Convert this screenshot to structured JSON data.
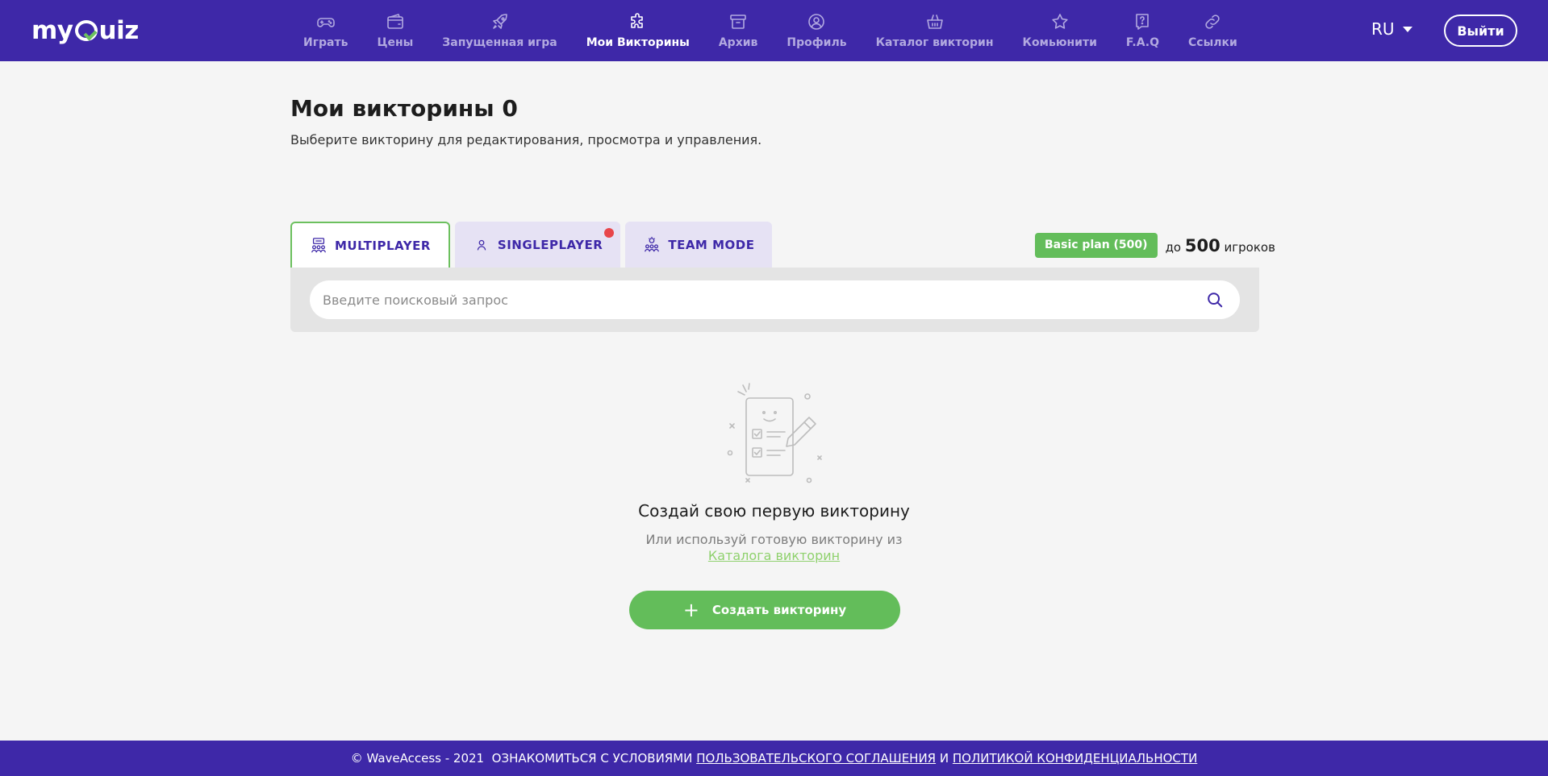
{
  "header": {
    "logo": "myQuiz",
    "nav": [
      {
        "label": "Играть",
        "icon": "gamepad-icon"
      },
      {
        "label": "Цены",
        "icon": "wallet-icon"
      },
      {
        "label": "Запущенная игра",
        "icon": "rocket-icon"
      },
      {
        "label": "Мои Викторины",
        "icon": "puzzle-icon",
        "active": true
      },
      {
        "label": "Архив",
        "icon": "archive-icon"
      },
      {
        "label": "Профиль",
        "icon": "profile-icon"
      },
      {
        "label": "Каталог викторин",
        "icon": "basket-icon"
      },
      {
        "label": "Комьюнити",
        "icon": "star-icon"
      },
      {
        "label": "F.A.Q",
        "icon": "help-icon"
      },
      {
        "label": "Ссылки",
        "icon": "link-icon"
      }
    ],
    "language": "RU",
    "logout_label": "Выйти"
  },
  "page": {
    "title": "Мои викторины 0",
    "subtitle": "Выберите викторину для редактирования, просмотра и управления."
  },
  "tabs": [
    {
      "label": "MULTIPLAYER",
      "icon": "multiplayer-icon",
      "active": true
    },
    {
      "label": "SINGLEPLAYER",
      "icon": "singleplayer-icon",
      "notification": true
    },
    {
      "label": "TEAM MODE",
      "icon": "team-icon"
    }
  ],
  "plan": {
    "badge": "Basic plan (500)",
    "prefix": "до",
    "count": "500",
    "suffix": "игроков"
  },
  "search": {
    "placeholder": "Введите поисковый запрос"
  },
  "empty": {
    "title": "Создай свою первую викторину",
    "subtitle": "Или используй готовую викторину из",
    "link": "Каталога викторин",
    "create_label": "Создать викторину"
  },
  "footer": {
    "copyright": "© WaveAccess - 2021",
    "terms_prefix": "ОЗНАКОМИТЬСЯ С УСЛОВИЯМИ",
    "agreement_link": "ПОЛЬЗОВАТЕЛЬСКОГО СОГЛАШЕНИЯ",
    "conjunction": "И",
    "privacy_link": "ПОЛИТИКОЙ КОНФИДЕНЦИАЛЬНОСТИ"
  },
  "colors": {
    "brand": "#3e28a8",
    "accent_green": "#63bd5a",
    "notification_red": "#e8464a",
    "background": "#f5f5f5"
  }
}
